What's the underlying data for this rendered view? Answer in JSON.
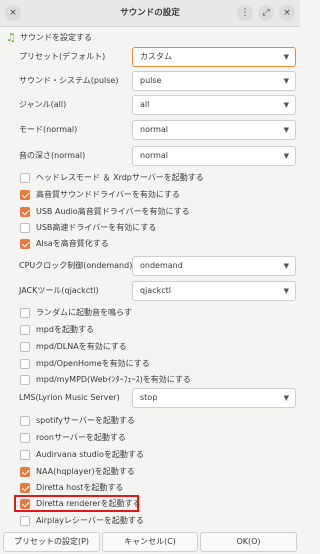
{
  "window": {
    "title": "サウンドの設定"
  },
  "header": {
    "label": "サウンドを設定する",
    "icon": "music-note-icon"
  },
  "fields": [
    {
      "label": "プリセット(デフォルト)",
      "value": "カスタム"
    },
    {
      "label": "サウンド・システム(pulse)",
      "value": "pulse"
    },
    {
      "label": "ジャンル(all)",
      "value": "all"
    },
    {
      "label": "モード(normal)",
      "value": "normal"
    },
    {
      "label": "音の深さ(normal)",
      "value": "normal"
    }
  ],
  "checks_a": [
    {
      "label": "ヘッドレスモード ＆ Xrdpサーバーを起動する",
      "checked": false
    },
    {
      "label": "高音質サウンドドライバーを有効にする",
      "checked": true
    },
    {
      "label": "USB Audio高音質ドライバーを有効にする",
      "checked": true
    },
    {
      "label": "USB高速ドライバーを有効にする",
      "checked": false
    },
    {
      "label": "Alsaを高音質化する",
      "checked": true
    }
  ],
  "cpu": {
    "label": "CPUクロック制御(ondemand)",
    "value": "ondemand"
  },
  "jack": {
    "label": "JACKツール(qjackctl)",
    "value": "qjackctl"
  },
  "checks_b": [
    {
      "label": "ランダムに起動音を鳴らす",
      "checked": false
    },
    {
      "label": "mpdを起動する",
      "checked": false
    },
    {
      "label": "mpd/DLNAを有効にする",
      "checked": false
    },
    {
      "label": "mpd/OpenHomeを有効にする",
      "checked": false
    },
    {
      "label": "mpd/myMPD(Webｲﾝﾀｰﾌｪｰｽ)を有効にする",
      "checked": false
    }
  ],
  "lms": {
    "label": "LMS(Lyrion Music Server)",
    "value": "stop"
  },
  "checks_c": [
    {
      "label": "spotifyサーバーを起動する",
      "checked": false
    },
    {
      "label": "roonサーバーを起動する",
      "checked": false
    },
    {
      "label": "Audirvana studioを起動する",
      "checked": false
    },
    {
      "label": "NAA(hqplayer)を起動する",
      "checked": true
    },
    {
      "label": "Diretta hostを起動する",
      "checked": true
    },
    {
      "label": "Diretta rendererを起動する",
      "checked": true
    },
    {
      "label": "Airplayレシーバーを起動する",
      "checked": false
    }
  ],
  "buttons": {
    "preset": "プリセットの設定(P)",
    "cancel": "キャンセル(C)",
    "ok": "OK(O)"
  },
  "titlebar_icons": [
    "close-icon",
    "maximize-icon",
    "minimize-icon",
    "menu-icon"
  ]
}
